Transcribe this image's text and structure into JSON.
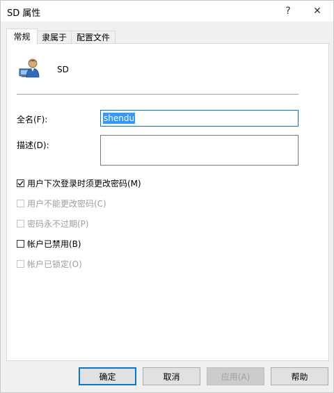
{
  "window": {
    "title": "SD 属性",
    "help_label": "?",
    "close_label": "✕"
  },
  "tabs": [
    {
      "label": "常规",
      "active": true
    },
    {
      "label": "隶属于",
      "active": false
    },
    {
      "label": "配置文件",
      "active": false
    }
  ],
  "user": {
    "name": "SD",
    "icon": "user-icon"
  },
  "fields": {
    "fullname": {
      "label": "全名(F):",
      "value": "shendu"
    },
    "description": {
      "label": "描述(D):",
      "value": ""
    }
  },
  "checkboxes": [
    {
      "label": "用户下次登录时须更改密码(M)",
      "checked": true,
      "enabled": true
    },
    {
      "label": "用户不能更改密码(C)",
      "checked": false,
      "enabled": false
    },
    {
      "label": "密码永不过期(P)",
      "checked": false,
      "enabled": false
    },
    {
      "label": "帐户已禁用(B)",
      "checked": false,
      "enabled": true
    },
    {
      "label": "帐户已锁定(O)",
      "checked": false,
      "enabled": false
    }
  ],
  "buttons": {
    "ok": "确定",
    "cancel": "取消",
    "apply": "应用(A)",
    "help": "帮助"
  },
  "colors": {
    "accent": "#0078d7",
    "selection": "#3399ff"
  }
}
